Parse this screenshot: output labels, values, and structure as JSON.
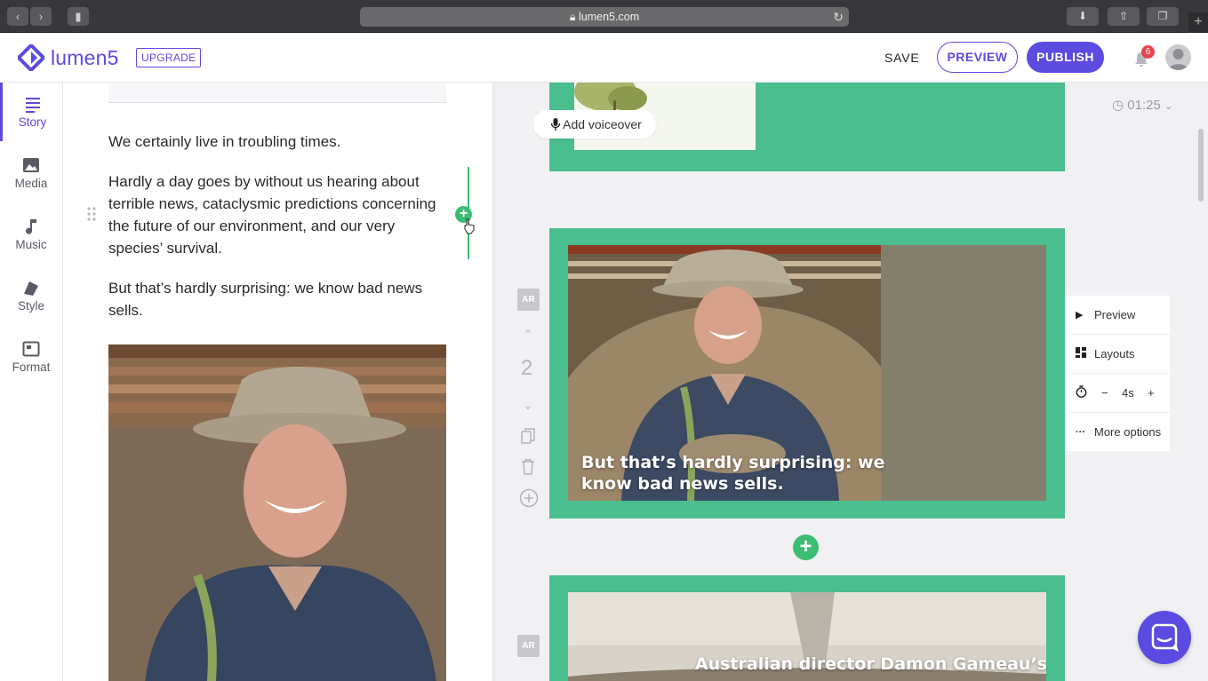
{
  "browser": {
    "url": "lumen5.com"
  },
  "header": {
    "brand": "lumen5",
    "upgrade_label": "UPGRADE",
    "save_label": "SAVE",
    "preview_label": "PREVIEW",
    "publish_label": "PUBLISH",
    "notification_count": "6"
  },
  "sidebar": {
    "items": [
      {
        "label": "Story",
        "icon": "story-icon"
      },
      {
        "label": "Media",
        "icon": "media-icon"
      },
      {
        "label": "Music",
        "icon": "music-icon"
      },
      {
        "label": "Style",
        "icon": "style-icon"
      },
      {
        "label": "Format",
        "icon": "format-icon"
      }
    ]
  },
  "story": {
    "paragraphs": [
      "We certainly live in troubling times.",
      "Hardly a day goes by without us hearing about terrible news, cataclysmic predictions concerning the future of our environment, and our very species’ survival.",
      "But that’s hardly surprising: we know bad news sells."
    ]
  },
  "canvas": {
    "duration": "01:25",
    "voiceover_label": "Add voiceover",
    "scenes": [
      {
        "ar": "AR",
        "number": "2",
        "caption": "But that’s hardly surprising: we know bad news sells."
      },
      {
        "ar": "AR",
        "caption": "Australian director Damon Gameau’s"
      }
    ],
    "menu": {
      "preview": "Preview",
      "layouts": "Layouts",
      "duration_value": "4s",
      "minus": "−",
      "plus": "+",
      "more": "More options"
    }
  },
  "colors": {
    "brand": "#5b4be0",
    "scene_bg": "#4abe8e",
    "add_green": "#3dbd73",
    "badge_red": "#e8434f"
  }
}
